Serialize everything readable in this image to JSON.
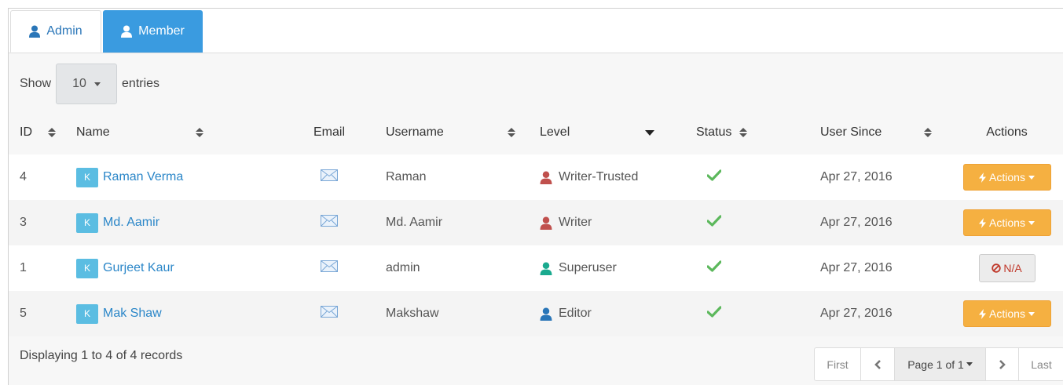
{
  "tabs": [
    {
      "label": "Admin",
      "icon": "user-icon",
      "active": false
    },
    {
      "label": "Member",
      "icon": "user-icon",
      "active": true
    }
  ],
  "length_control": {
    "prefix": "Show",
    "value": "10",
    "suffix": "entries"
  },
  "columns": {
    "id": "ID",
    "name": "Name",
    "email": "Email",
    "username": "Username",
    "level": "Level",
    "status": "Status",
    "user_since": "User Since",
    "actions": "Actions"
  },
  "badge_letter": "K",
  "rows": [
    {
      "id": "4",
      "name": "Raman Verma",
      "username": "Raman",
      "level": "Writer-Trusted",
      "level_color": "#c0504d",
      "status": "active",
      "user_since": "Apr 27, 2016",
      "action": "Actions"
    },
    {
      "id": "3",
      "name": "Md. Aamir",
      "username": "Md. Aamir",
      "level": "Writer",
      "level_color": "#c0504d",
      "status": "active",
      "user_since": "Apr 27, 2016",
      "action": "Actions"
    },
    {
      "id": "1",
      "name": "Gurjeet Kaur",
      "username": "admin",
      "level": "Superuser",
      "level_color": "#1aaa8f",
      "status": "active",
      "user_since": "Apr 27, 2016",
      "action": "N/A"
    },
    {
      "id": "5",
      "name": "Mak Shaw",
      "username": "Makshaw",
      "level": "Editor",
      "level_color": "#2a76b8",
      "status": "active",
      "user_since": "Apr 27, 2016",
      "action": "Actions"
    }
  ],
  "footer": {
    "info": "Displaying 1 to 4 of 4 records"
  },
  "pager": {
    "first": "First",
    "page": "Page 1 of 1",
    "last": "Last"
  },
  "colors": {
    "tab_active": "#3a9be0",
    "link": "#2a86c8",
    "actions_button": "#f5b041",
    "check": "#5cb85c"
  }
}
